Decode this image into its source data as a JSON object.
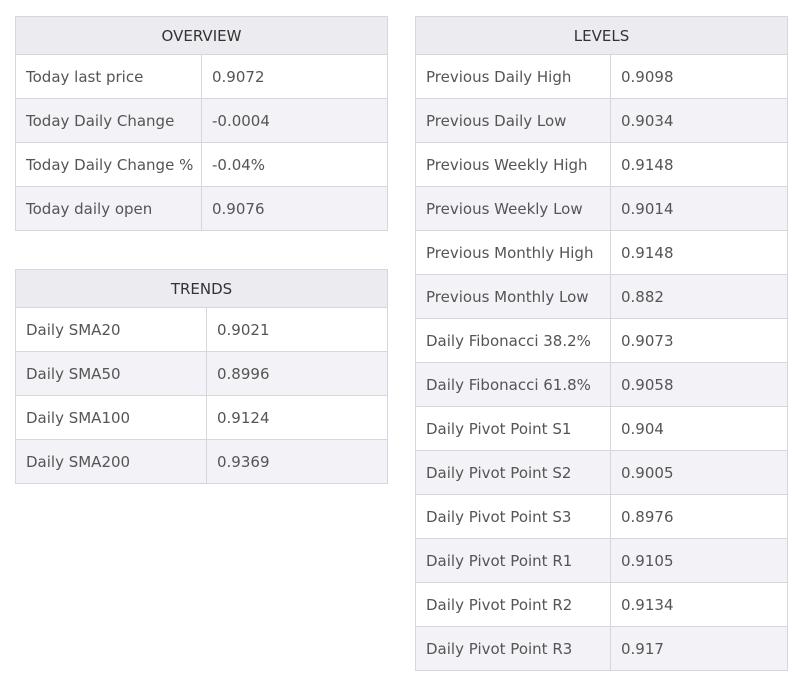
{
  "overview": {
    "title": "OVERVIEW",
    "rows": [
      {
        "label": "Today last price",
        "value": "0.9072"
      },
      {
        "label": "Today Daily Change",
        "value": "-0.0004"
      },
      {
        "label": "Today Daily Change %",
        "value": "-0.04%"
      },
      {
        "label": "Today daily open",
        "value": "0.9076"
      }
    ]
  },
  "trends": {
    "title": "TRENDS",
    "rows": [
      {
        "label": "Daily SMA20",
        "value": "0.9021"
      },
      {
        "label": "Daily SMA50",
        "value": "0.8996"
      },
      {
        "label": "Daily SMA100",
        "value": "0.9124"
      },
      {
        "label": "Daily SMA200",
        "value": "0.9369"
      }
    ]
  },
  "levels": {
    "title": "LEVELS",
    "rows": [
      {
        "label": "Previous Daily High",
        "value": "0.9098"
      },
      {
        "label": "Previous Daily Low",
        "value": "0.9034"
      },
      {
        "label": "Previous Weekly High",
        "value": "0.9148"
      },
      {
        "label": "Previous Weekly Low",
        "value": "0.9014"
      },
      {
        "label": "Previous Monthly High",
        "value": "0.9148"
      },
      {
        "label": "Previous Monthly Low",
        "value": "0.882"
      },
      {
        "label": "Daily Fibonacci 38.2%",
        "value": "0.9073"
      },
      {
        "label": "Daily Fibonacci 61.8%",
        "value": "0.9058"
      },
      {
        "label": "Daily Pivot Point S1",
        "value": "0.904"
      },
      {
        "label": "Daily Pivot Point S2",
        "value": "0.9005"
      },
      {
        "label": "Daily Pivot Point S3",
        "value": "0.8976"
      },
      {
        "label": "Daily Pivot Point R1",
        "value": "0.9105"
      },
      {
        "label": "Daily Pivot Point R2",
        "value": "0.9134"
      },
      {
        "label": "Daily Pivot Point R3",
        "value": "0.917"
      }
    ]
  }
}
